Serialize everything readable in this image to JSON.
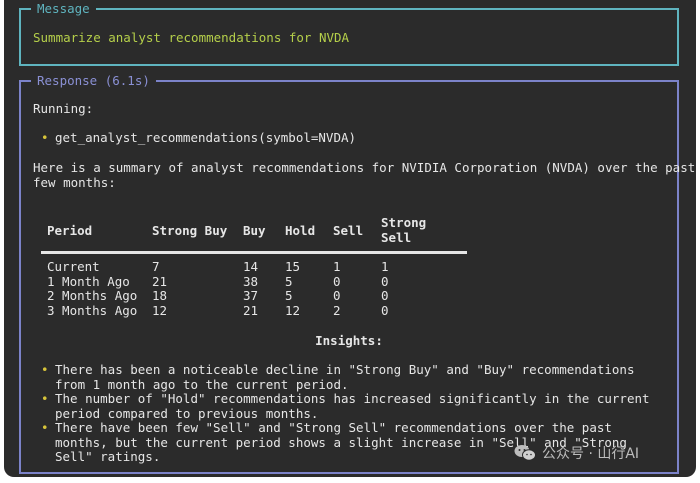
{
  "message": {
    "legend": "Message",
    "text": "Summarize analyst recommendations for NVDA"
  },
  "response": {
    "legend": "Response (6.1s)",
    "running_label": "Running:",
    "tool_call": "get_analyst_recommendations(symbol=NVDA)",
    "summary_line1": "Here is a summary of analyst recommendations for NVIDIA Corporation (NVDA) over the past",
    "summary_line2": "few months:",
    "table": {
      "headers": [
        "Period",
        "Strong Buy",
        "Buy",
        "Hold",
        "Sell",
        "Strong Sell"
      ],
      "rows": [
        [
          "Current",
          "7",
          "14",
          "15",
          "1",
          "1"
        ],
        [
          "1 Month Ago",
          "21",
          "38",
          "5",
          "0",
          "0"
        ],
        [
          "2 Months Ago",
          "18",
          "37",
          "5",
          "0",
          "0"
        ],
        [
          "3 Months Ago",
          "12",
          "21",
          "12",
          "2",
          "0"
        ]
      ]
    },
    "insights_title": "Insights:",
    "insights": [
      "There has been a noticeable decline in \"Strong Buy\" and \"Buy\" recommendations from 1 month ago to the current period.",
      "The number of \"Hold\" recommendations has increased significantly in the current period compared to previous months.",
      "There have been few \"Sell\" and \"Strong Sell\" recommendations over the past months, but the current period shows a slight increase in \"Sell\" and \"Strong Sell\" ratings."
    ]
  },
  "watermark": {
    "text": "公众号 · 山行AI"
  },
  "colors": {
    "message_border": "#5fb4bf",
    "response_border": "#7c83c9",
    "message_text": "#b5cf4a",
    "bullet": "#d7c43a",
    "background": "#2b2b2b"
  }
}
